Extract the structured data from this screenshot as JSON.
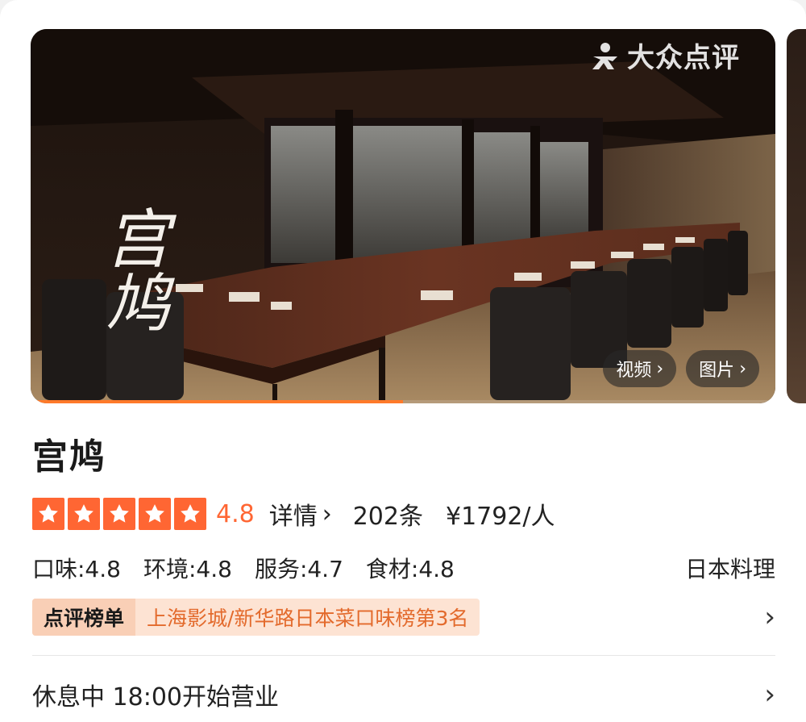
{
  "gallery": {
    "watermark": "大众点评",
    "calligraphy": "宫鸠",
    "video_label": "视频",
    "photos_label": "图片",
    "progress": 0.5
  },
  "shop": {
    "name": "宫鸠",
    "rating": "4.8",
    "star_count": 5,
    "details_label": "详情",
    "review_count": "202条",
    "price": "¥1792/人",
    "sub_scores": {
      "taste": "口味:4.8",
      "environment": "环境:4.8",
      "service": "服务:4.7",
      "ingredients": "食材:4.8"
    },
    "cuisine": "日本料理",
    "ranking_tag": "点评榜单",
    "ranking_text": "上海影城/新华路日本菜口味榜第3名",
    "hours": "休息中 18:00开始营业"
  },
  "colors": {
    "accent": "#ff6633",
    "rank_text": "#e36a2c",
    "rank_bg": "#fde3d3"
  }
}
